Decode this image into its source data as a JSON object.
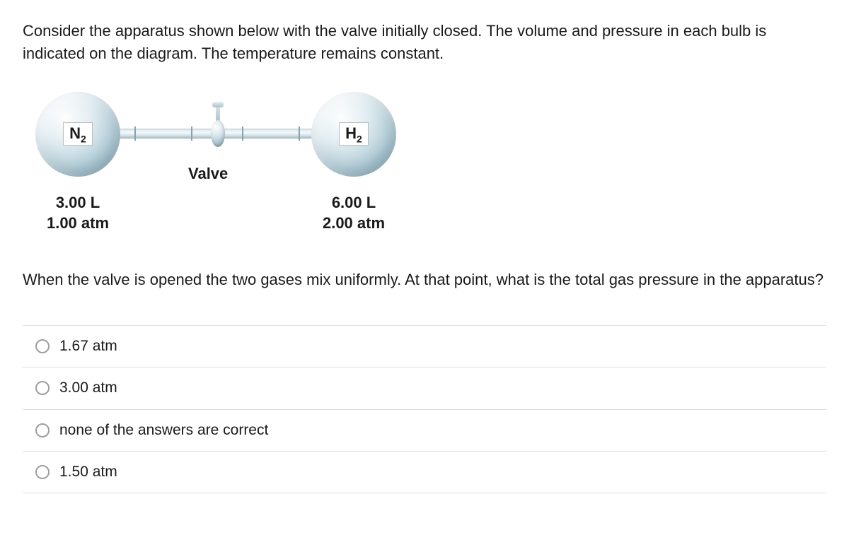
{
  "question": {
    "intro": "Consider the apparatus shown below with the valve initially closed. The volume and pressure in each bulb is indicated on the diagram. The temperature remains constant.",
    "followup": "When the valve is opened the two gases mix uniformly. At that point, what is the total gas pressure in the apparatus?"
  },
  "apparatus": {
    "valve_label": "Valve",
    "left": {
      "gas_base": "N",
      "gas_sub": "2",
      "volume": "3.00 L",
      "pressure": "1.00 atm"
    },
    "right": {
      "gas_base": "H",
      "gas_sub": "2",
      "volume": "6.00 L",
      "pressure": "2.00 atm"
    }
  },
  "options": [
    {
      "label": "1.67 atm"
    },
    {
      "label": "3.00 atm"
    },
    {
      "label": "none of the answers are correct"
    },
    {
      "label": "1.50 atm"
    }
  ]
}
